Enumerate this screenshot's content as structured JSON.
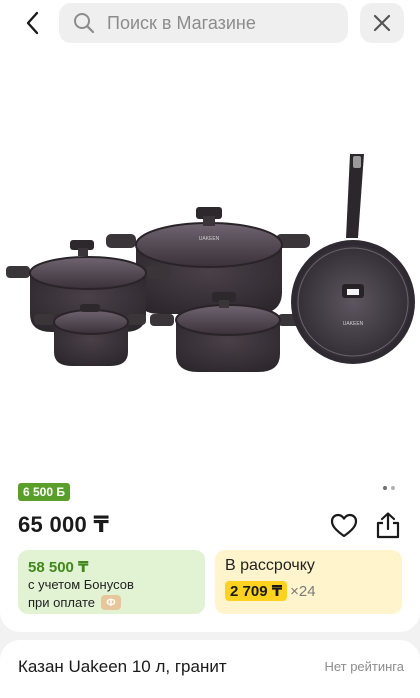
{
  "header": {
    "search_placeholder": "Поиск в Магазине"
  },
  "product": {
    "image_alt": "Набор посуды Uakeen",
    "brand_on_lid": "UAKEEN",
    "bonus_badge": "6 500 Б",
    "price": "65 000 ₸",
    "bonus_price": {
      "amount": "58 500 ₸",
      "line1": "с учетом Бонусов",
      "line2": "при оплате",
      "coin_symbol": "Ф"
    },
    "installment": {
      "title": "В рассрочку",
      "monthly": "2 709 ₸",
      "months": "×24"
    },
    "title": "Казан Uakeen 10 л, гранит",
    "rating_text": "Нет рейтинга",
    "gallery": {
      "total": 2,
      "active": 1
    }
  },
  "colors": {
    "bonus_green": "#5a9f2a",
    "bonus_bg": "#e2f3d4",
    "installment_bg": "#fff4cc",
    "installment_pill": "#ffd21f"
  }
}
